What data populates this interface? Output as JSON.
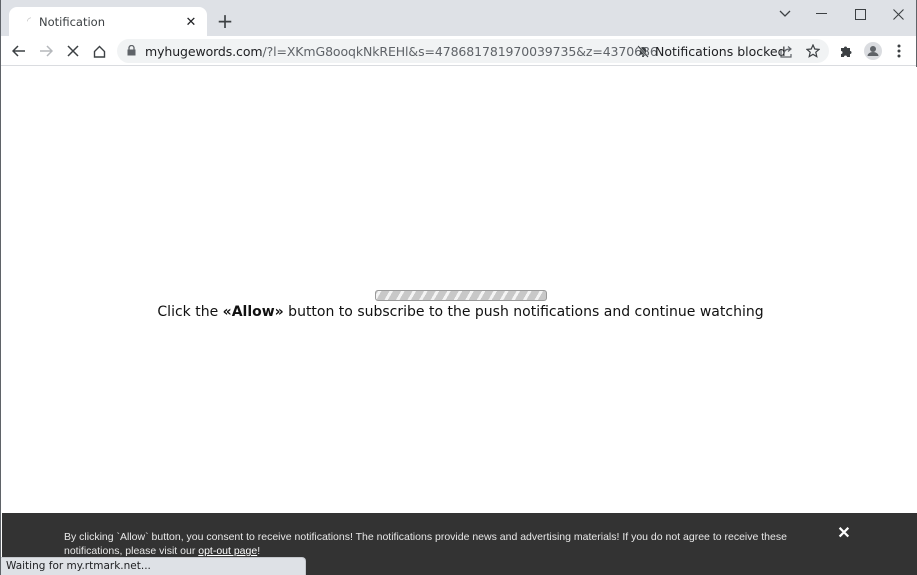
{
  "browser": {
    "tab": {
      "title": "Notification"
    },
    "address_bar": {
      "host": "myhugewords.com",
      "path": "/?l=XKmG8ooqkNkREHl&s=478681781970039735&z=4370686"
    },
    "notifications_indicator": "Notifications blocked",
    "status_text": "Waiting for my.rtmark.net..."
  },
  "page": {
    "loading_progress_label": "indeterminate",
    "message": {
      "before": "Click the ",
      "emphasis": "«Allow»",
      "after": " button to subscribe to the push notifications and continue watching"
    }
  },
  "consent_banner": {
    "text": "By clicking `Allow` button, you consent to receive notifications! The notifications provide news and advertising materials! If you do not agree to receive these notifications, please visit our ",
    "link_label": "opt-out page",
    "suffix": "!",
    "close_label": "✕"
  },
  "colors": {
    "banner_bg": "#333333",
    "titlebar_bg": "#dee1e6",
    "omnibox_bg": "#f1f3f4"
  }
}
